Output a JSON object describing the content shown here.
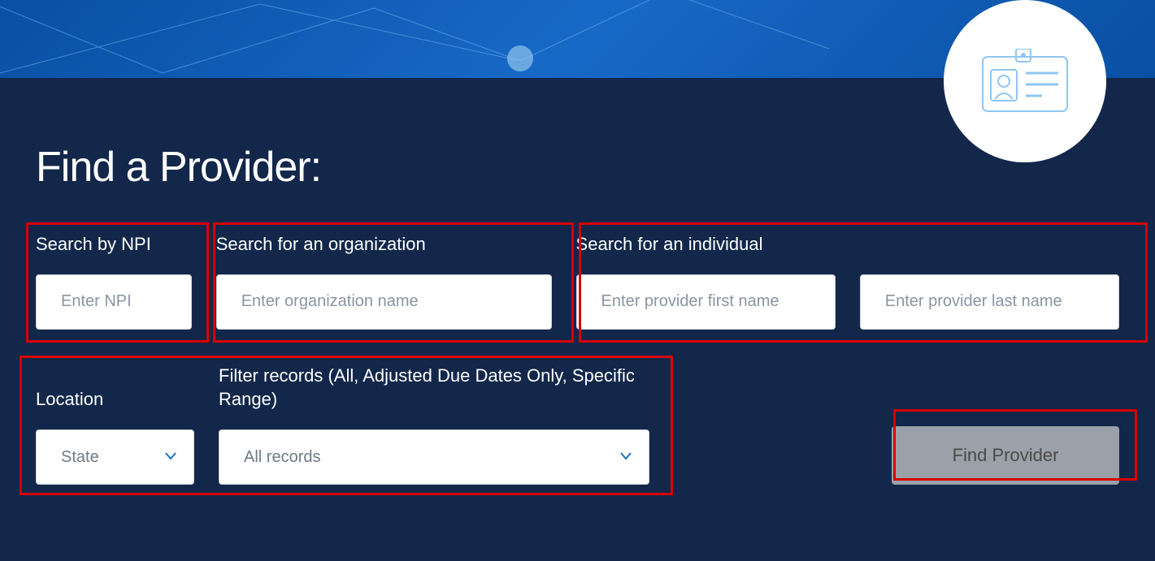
{
  "header": {
    "icon_name": "id-badge-icon"
  },
  "page": {
    "title": "Find a Provider:"
  },
  "search": {
    "npi": {
      "label": "Search by NPI",
      "placeholder": "Enter NPI"
    },
    "org": {
      "label": "Search for an organization",
      "placeholder": "Enter organization name"
    },
    "individual": {
      "label": "Search for an individual",
      "first_placeholder": "Enter provider first name",
      "last_placeholder": "Enter provider last name"
    },
    "location": {
      "label": "Location",
      "selected": "State"
    },
    "filter": {
      "label": "Filter records (All, Adjusted Due Dates Only, Specific Range)",
      "selected": "All records"
    },
    "button": "Find Provider"
  }
}
